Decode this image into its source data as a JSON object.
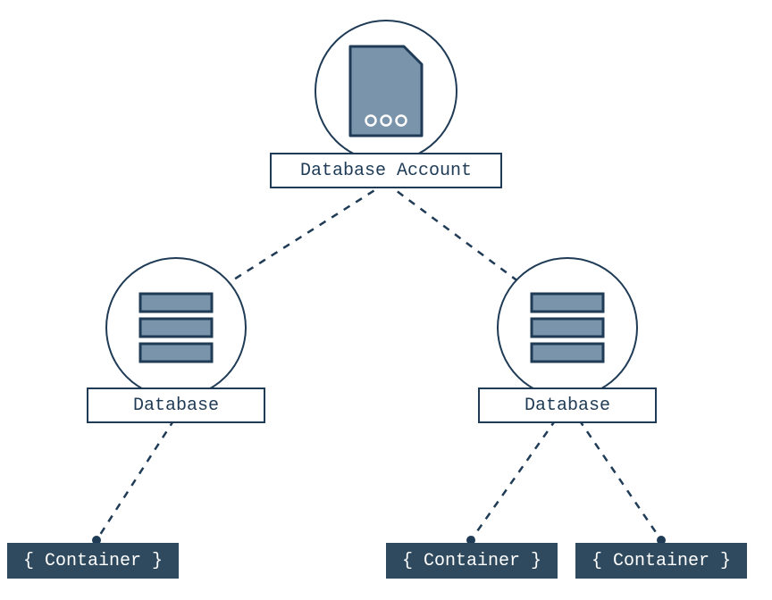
{
  "diagram": {
    "root": {
      "label": "Database Account"
    },
    "databases": [
      {
        "label": "Database"
      },
      {
        "label": "Database"
      }
    ],
    "containers": [
      {
        "label": "{ Container }"
      },
      {
        "label": "{ Container }"
      },
      {
        "label": "{ Container }"
      }
    ],
    "colors": {
      "stroke": "#1f3b56",
      "fill": "#7a95ab",
      "containerBg": "#2f4a5e",
      "white": "#ffffff"
    }
  }
}
